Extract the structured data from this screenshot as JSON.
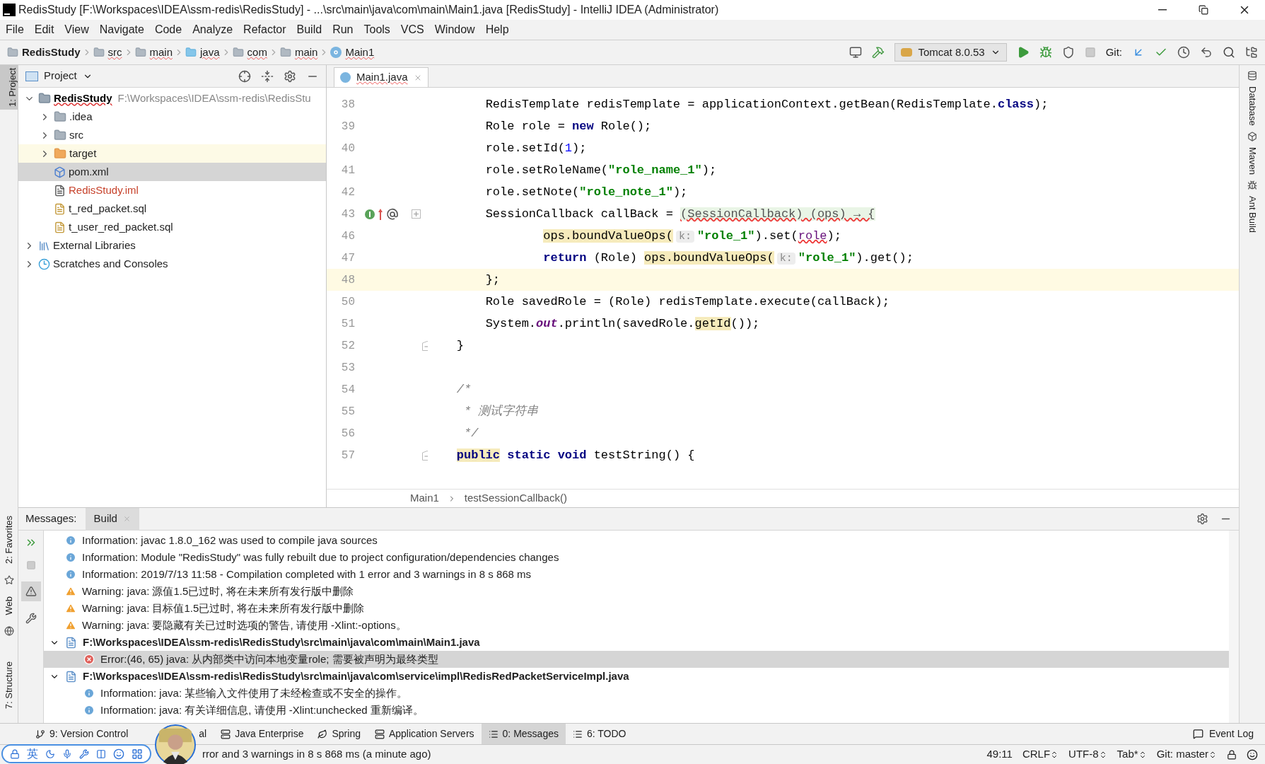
{
  "window": {
    "title": "RedisStudy [F:\\Workspaces\\IDEA\\ssm-redis\\RedisStudy] - ...\\src\\main\\java\\com\\main\\Main1.java [RedisStudy] - IntelliJ IDEA (Administrator)"
  },
  "menu": [
    "File",
    "Edit",
    "View",
    "Navigate",
    "Code",
    "Analyze",
    "Refactor",
    "Build",
    "Run",
    "Tools",
    "VCS",
    "Window",
    "Help"
  ],
  "nav_path": [
    {
      "label": "RedisStudy",
      "kind": "project"
    },
    {
      "label": "src",
      "kind": "folder"
    },
    {
      "label": "main",
      "kind": "folder"
    },
    {
      "label": "java",
      "kind": "source"
    },
    {
      "label": "com",
      "kind": "package"
    },
    {
      "label": "main",
      "kind": "package"
    },
    {
      "label": "Main1",
      "kind": "class"
    }
  ],
  "run_config": "Tomcat 8.0.53",
  "git_label": "Git:",
  "left_strip": [
    {
      "label": "1: Project",
      "selected": true
    },
    {
      "label": "2: Favorites",
      "selected": false
    },
    {
      "label": "Web",
      "selected": false
    },
    {
      "label": "7: Structure",
      "selected": false
    }
  ],
  "right_strip": [
    {
      "label": "Database",
      "selected": false
    },
    {
      "label": "Maven",
      "selected": false
    },
    {
      "label": "Ant Build",
      "selected": false
    }
  ],
  "project": {
    "title": "Project",
    "tree": [
      {
        "label": "RedisStudy",
        "path": "F:\\Workspaces\\IDEA\\ssm-redis\\RedisStu",
        "kind": "project",
        "expanded": true,
        "children": [
          {
            "label": ".idea",
            "kind": "folder",
            "expanded": false,
            "selected": false,
            "excluded": false
          },
          {
            "label": "src",
            "kind": "folder",
            "expanded": false,
            "selected": false,
            "excluded": false
          },
          {
            "label": "target",
            "kind": "folder",
            "expanded": false,
            "selected": false,
            "excluded": true
          },
          {
            "label": "pom.xml",
            "kind": "maven",
            "selected": true,
            "excluded": false
          },
          {
            "label": "RedisStudy.iml",
            "kind": "iml",
            "selected": false,
            "excluded": false,
            "color": "#c7422b"
          },
          {
            "label": "t_red_packet.sql",
            "kind": "sql",
            "selected": false,
            "excluded": false
          },
          {
            "label": "t_user_red_packet.sql",
            "kind": "sql",
            "selected": false,
            "excluded": false
          }
        ]
      },
      {
        "label": "External Libraries",
        "kind": "libraries",
        "expanded": false
      },
      {
        "label": "Scratches and Consoles",
        "kind": "scratches",
        "expanded": false
      }
    ]
  },
  "editor": {
    "tabs": [
      {
        "label": "Main1.java",
        "selected": true
      }
    ],
    "lines": [
      {
        "number": "38",
        "current": false,
        "kind": "code",
        "segments": [
          {
            "kind": "plain",
            "text": "        RedisTemplate redisTemplate = applicationContext.getBean(RedisTemplate."
          },
          {
            "kind": "keyword",
            "text": "class"
          },
          {
            "kind": "plain",
            "text": ");"
          }
        ]
      },
      {
        "number": "39",
        "current": false,
        "kind": "code",
        "segments": [
          {
            "kind": "plain",
            "text": "        Role role = "
          },
          {
            "kind": "keyword",
            "text": "new"
          },
          {
            "kind": "plain",
            "text": " Role();"
          }
        ]
      },
      {
        "number": "40",
        "current": false,
        "kind": "code",
        "segments": [
          {
            "kind": "plain",
            "text": "        role.setId("
          },
          {
            "kind": "number",
            "text": "1"
          },
          {
            "kind": "plain",
            "text": ");"
          }
        ]
      },
      {
        "number": "41",
        "current": false,
        "kind": "code",
        "segments": [
          {
            "kind": "plain",
            "text": "        role.setRoleName("
          },
          {
            "kind": "string",
            "text": "\"role_name_1\""
          },
          {
            "kind": "plain",
            "text": ");"
          }
        ]
      },
      {
        "number": "42",
        "current": false,
        "kind": "code",
        "segments": [
          {
            "kind": "plain",
            "text": "        role.setNote("
          },
          {
            "kind": "string",
            "text": "\"role_note_1\""
          },
          {
            "kind": "plain",
            "text": ");"
          }
        ]
      },
      {
        "number": "43",
        "current": false,
        "kind": "lambda",
        "segments": [
          {
            "kind": "plain",
            "text": "        SessionCallback callBack = "
          },
          {
            "kind": "folded",
            "text": "(SessionCallback) (ops) → {"
          }
        ]
      },
      {
        "number": "46",
        "current": false,
        "kind": "code",
        "segments": [
          {
            "kind": "usage",
            "text": "                ops.boundValueOps("
          },
          {
            "kind": "hint",
            "text": "k:"
          },
          {
            "kind": "string",
            "text": "\"role_1\""
          },
          {
            "kind": "plain",
            "text": ").set("
          },
          {
            "kind": "error",
            "text": "role"
          },
          {
            "kind": "plain",
            "text": ");"
          }
        ]
      },
      {
        "number": "47",
        "current": false,
        "kind": "code",
        "segments": [
          {
            "kind": "keyword",
            "text": "                return"
          },
          {
            "kind": "plain",
            "text": " (Role) "
          },
          {
            "kind": "usage",
            "text": "ops.boundValueOps("
          },
          {
            "kind": "hint",
            "text": "k:"
          },
          {
            "kind": "string",
            "text": "\"role_1\""
          },
          {
            "kind": "plain",
            "text": ").get();"
          }
        ]
      },
      {
        "number": "48",
        "current": true,
        "kind": "code",
        "segments": [
          {
            "kind": "plain",
            "text": "        };"
          }
        ]
      },
      {
        "number": "50",
        "current": false,
        "kind": "code",
        "segments": [
          {
            "kind": "plain",
            "text": "        Role savedRole = (Role) redisTemplate.execute(callBack);"
          }
        ]
      },
      {
        "number": "51",
        "current": false,
        "kind": "code",
        "segments": [
          {
            "kind": "plain",
            "text": "        System."
          },
          {
            "kind": "field",
            "text": "out"
          },
          {
            "kind": "plain",
            "text": ".println(savedRole."
          },
          {
            "kind": "usage",
            "text": "getId"
          },
          {
            "kind": "plain",
            "text": "());"
          }
        ]
      },
      {
        "number": "52",
        "current": false,
        "kind": "fold-end",
        "segments": [
          {
            "kind": "plain",
            "text": "    }"
          }
        ]
      },
      {
        "number": "53",
        "current": false,
        "kind": "code"
      },
      {
        "number": "54",
        "current": false,
        "kind": "code",
        "segments": [
          {
            "kind": "comment",
            "text": "    /*"
          }
        ]
      },
      {
        "number": "55",
        "current": false,
        "kind": "code",
        "segments": [
          {
            "kind": "comment",
            "text": "     * 测试字符串"
          }
        ]
      },
      {
        "number": "56",
        "current": false,
        "kind": "code",
        "segments": [
          {
            "kind": "comment",
            "text": "     */"
          }
        ]
      },
      {
        "number": "57",
        "current": false,
        "kind": "fold-start",
        "segments": [
          {
            "kind": "usage-keyword",
            "text": "    public"
          },
          {
            "kind": "keyword",
            "text": " static"
          },
          {
            "kind": "keyword",
            "text": " void"
          },
          {
            "kind": "plain",
            "text": " testString() {"
          }
        ]
      }
    ],
    "breadcrumbs": [
      "Main1",
      "testSessionCallback()"
    ]
  },
  "messages": {
    "label": "Messages:",
    "tabs": [
      {
        "label": "Build",
        "selected": true
      }
    ],
    "items": [
      {
        "kind": "info",
        "text": "Information: javac 1.8.0_162 was used to compile java sources"
      },
      {
        "kind": "info",
        "text": "Information: Module \"RedisStudy\" was fully rebuilt due to project configuration/dependencies changes"
      },
      {
        "kind": "info",
        "text": "Information: 2019/7/13 11:58 - Compilation completed with 1 error and 3 warnings in 8 s 868 ms"
      },
      {
        "kind": "warning",
        "text": "Warning: java: 源值1.5已过时, 将在未来所有发行版中删除"
      },
      {
        "kind": "warning",
        "text": "Warning: java: 目标值1.5已过时, 将在未来所有发行版中删除"
      },
      {
        "kind": "warning",
        "text": "Warning: java: 要隐藏有关已过时选项的警告, 请使用 -Xlint:-options。"
      },
      {
        "kind": "file",
        "text": "F:\\Workspaces\\IDEA\\ssm-redis\\RedisStudy\\src\\main\\java\\com\\main\\Main1.java",
        "expanded": true,
        "children": [
          {
            "kind": "error",
            "text": "Error:(46, 65)  java: 从内部类中访问本地变量role; 需要被声明为最终类型",
            "selected": true
          }
        ]
      },
      {
        "kind": "file",
        "text": "F:\\Workspaces\\IDEA\\ssm-redis\\RedisStudy\\src\\main\\java\\com\\service\\impl\\RedisRedPacketServiceImpl.java",
        "expanded": true,
        "children": [
          {
            "kind": "info",
            "text": "Information: java: 某些输入文件使用了未经检查或不安全的操作。",
            "selected": false
          },
          {
            "kind": "info",
            "text": "Information: java: 有关详细信息, 请使用 -Xlint:unchecked 重新编译。",
            "selected": false
          }
        ]
      }
    ]
  },
  "tool_tabs": [
    {
      "label": "9: Version Control",
      "kind": "vcs",
      "selected": false
    },
    {
      "label": "al",
      "kind": "terminal",
      "selected": false
    },
    {
      "label": "Java Enterprise",
      "kind": "javaee",
      "selected": false
    },
    {
      "label": "Spring",
      "kind": "spring",
      "selected": false
    },
    {
      "label": "Application Servers",
      "kind": "servers",
      "selected": false
    },
    {
      "label": "0: Messages",
      "kind": "messages",
      "selected": true
    },
    {
      "label": "6: TODO",
      "kind": "todo",
      "selected": false
    }
  ],
  "event_log": "Event Log",
  "status_bar": {
    "message": "rror and 3 warnings in 8 s 868 ms (a minute ago)",
    "position": "49:11",
    "line_separator": "CRLF",
    "encoding": "UTF-8",
    "indent": "Tab*",
    "branch": "Git: master"
  },
  "ime_bar": {
    "language": "英"
  }
}
